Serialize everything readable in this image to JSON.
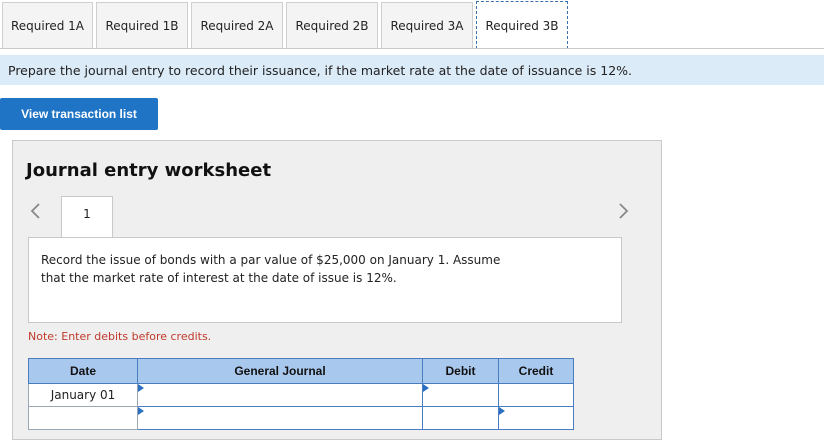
{
  "tabs": [
    {
      "label": "Required 1A",
      "active": false
    },
    {
      "label": "Required 1B",
      "active": false
    },
    {
      "label": "Required 2A",
      "active": false
    },
    {
      "label": "Required 2B",
      "active": false
    },
    {
      "label": "Required 3A",
      "active": false
    },
    {
      "label": "Required 3B",
      "active": true
    }
  ],
  "instruction": "Prepare the journal entry to record their issuance, if the market rate at the date of issuance is 12%.",
  "view_button": "View transaction list",
  "worksheet": {
    "title": "Journal entry worksheet",
    "page_number": "1",
    "description_line1": "Record the issue of bonds with a par value of $25,000 on January 1. Assume",
    "description_line2": "that the market rate of interest at the date of issue is 12%.",
    "note": "Note: Enter debits before credits."
  },
  "journal": {
    "headers": {
      "date": "Date",
      "general_journal": "General Journal",
      "debit": "Debit",
      "credit": "Credit"
    },
    "rows": [
      {
        "date": "January 01"
      },
      {
        "date": ""
      }
    ]
  },
  "colors": {
    "button_blue": "#1f74c5",
    "instruction_bg": "#dcebf8",
    "table_header": "#a9c8ed",
    "note_red": "#c0392b"
  }
}
